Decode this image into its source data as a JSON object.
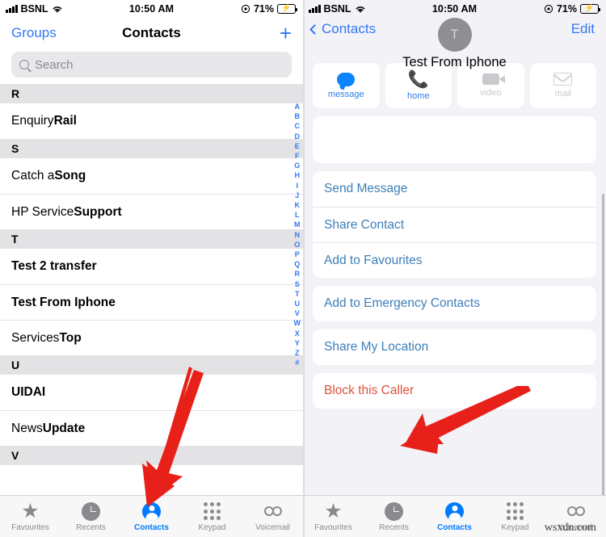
{
  "status_bar": {
    "carrier": "BSNL",
    "time": "10:50 AM",
    "battery_percent": "71%",
    "wifi_icon": "wifi-icon",
    "signal_icon": "signal-bars-icon",
    "location_icon": "location-arrow-icon",
    "battery_icon": "battery-charging-icon"
  },
  "left_screen": {
    "nav": {
      "groups_label": "Groups",
      "title": "Contacts",
      "add_label": "+"
    },
    "search": {
      "placeholder": "Search",
      "value": ""
    },
    "sections": [
      {
        "letter": "R",
        "contacts": [
          {
            "first": "Enquiry ",
            "last": "Rail"
          }
        ]
      },
      {
        "letter": "S",
        "contacts": [
          {
            "first": "Catch a ",
            "last": "Song"
          },
          {
            "first": "HP Service ",
            "last": "Support"
          }
        ]
      },
      {
        "letter": "T",
        "contacts": [
          {
            "first": "",
            "last": "Test 2 transfer"
          },
          {
            "first": "",
            "last": "Test From Iphone"
          },
          {
            "first": "Services ",
            "last": "Top"
          }
        ]
      },
      {
        "letter": "U",
        "contacts": [
          {
            "first": "",
            "last": "UIDAI"
          },
          {
            "first": "News ",
            "last": "Update"
          }
        ]
      },
      {
        "letter": "V",
        "contacts": []
      }
    ],
    "alpha_index": [
      "A",
      "B",
      "C",
      "D",
      "E",
      "F",
      "G",
      "H",
      "I",
      "J",
      "K",
      "L",
      "M",
      "N",
      "O",
      "P",
      "Q",
      "R",
      "S",
      "T",
      "U",
      "V",
      "W",
      "X",
      "Y",
      "Z",
      "#"
    ]
  },
  "right_screen": {
    "nav": {
      "back_label": "Contacts",
      "edit_label": "Edit"
    },
    "contact": {
      "avatar_initial": "T",
      "name": "Test From Iphone"
    },
    "quick_actions": [
      {
        "label": "message",
        "icon": "message-bubble-icon",
        "enabled": true
      },
      {
        "label": "home",
        "icon": "phone-handset-icon",
        "enabled": true
      },
      {
        "label": "video",
        "icon": "video-camera-icon",
        "enabled": false
      },
      {
        "label": "mail",
        "icon": "envelope-icon",
        "enabled": false
      }
    ],
    "card_groups": [
      {
        "items": []
      },
      {
        "items": [
          {
            "label": "Send Message",
            "style": "blue"
          },
          {
            "label": "Share Contact",
            "style": "blue"
          },
          {
            "label": "Add to Favourites",
            "style": "blue"
          }
        ]
      },
      {
        "items": [
          {
            "label": "Add to Emergency Contacts",
            "style": "blue"
          }
        ]
      },
      {
        "items": [
          {
            "label": "Share My Location",
            "style": "blue"
          }
        ]
      },
      {
        "items": [
          {
            "label": "Block this Caller",
            "style": "danger"
          }
        ]
      }
    ]
  },
  "tab_bar": {
    "tabs": [
      {
        "label": "Favourites",
        "icon": "star-icon",
        "active": false
      },
      {
        "label": "Recents",
        "icon": "clock-icon",
        "active": false
      },
      {
        "label": "Contacts",
        "icon": "person-circle-icon",
        "active": true
      },
      {
        "label": "Keypad",
        "icon": "keypad-dots-icon",
        "active": false
      },
      {
        "label": "Voicemail",
        "icon": "voicemail-icon",
        "active": false
      }
    ]
  },
  "annotations": {
    "arrow_color": "#e8201a",
    "left_arrow_target": "Contacts tab",
    "right_arrow_target": "Block this Caller"
  },
  "watermark": {
    "text": "wsxdn.com"
  },
  "colors": {
    "accent_blue": "#007aff",
    "link_blue": "#3478f6",
    "danger_red": "#e0503d",
    "arrow_red": "#e8201a",
    "section_gray": "#e3e3e6",
    "page_bg": "#f2f2f7"
  }
}
